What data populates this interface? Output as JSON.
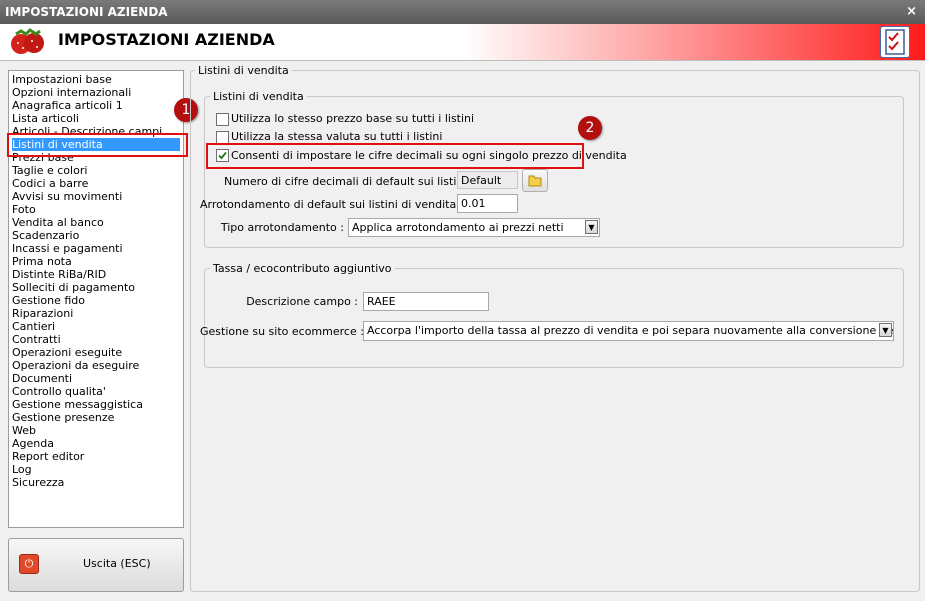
{
  "window": {
    "title": "IMPOSTAZIONI AZIENDA",
    "close_glyph": "×"
  },
  "header": {
    "title": "IMPOSTAZIONI AZIENDA",
    "logo_icon": "strawberry-icon",
    "checklist_icon": "checklist-icon"
  },
  "sidebar": {
    "items": [
      "Impostazioni base",
      "Opzioni internazionali",
      "Anagrafica articoli 1",
      "Lista articoli",
      "Articoli - Descrizione campi",
      "Listini di vendita",
      "Prezzi base",
      "Taglie e colori",
      "Codici a barre",
      "Avvisi su movimenti",
      "Foto",
      "Vendita al banco",
      "Scadenzario",
      "Incassi e pagamenti",
      "Prima nota",
      "Distinte RiBa/RID",
      "Solleciti di pagamento",
      "Gestione fido",
      "Riparazioni",
      "Cantieri",
      "Contratti",
      "Operazioni eseguite",
      "Operazioni da eseguire",
      "Documenti",
      "Controllo qualita'",
      "Gestione messaggistica",
      "Gestione presenze",
      "Web",
      "Agenda",
      "Report editor",
      "Log",
      "Sicurezza"
    ],
    "selected": "Listini di vendita"
  },
  "exit_button": {
    "label": "Uscita (ESC)",
    "icon": "power-icon"
  },
  "badges": {
    "one": "1",
    "two": "2"
  },
  "panel": {
    "title": "Listini di vendita",
    "group_listini": {
      "title": "Listini di vendita",
      "check_same_price": {
        "label": "Utilizza lo stesso prezzo base su tutti i listini",
        "checked": false
      },
      "check_same_currency": {
        "label": "Utilizza la stessa valuta su tutti i listini",
        "checked": false
      },
      "check_decimals": {
        "label": "Consenti di impostare le cifre decimali su ogni singolo prezzo di vendita",
        "checked": true
      },
      "decimals_label": "Numero di cifre decimali di default sui listini :",
      "decimals_value": "Default",
      "rounding_label": "Arrotondamento di default sui listini di vendita :",
      "rounding_value": "0.01",
      "rounding_type_label": "Tipo arrotondamento :",
      "rounding_type_value": "Applica arrotondamento ai prezzi netti"
    },
    "group_tax": {
      "title": "Tassa / ecocontributo aggiuntivo",
      "desc_label": "Descrizione campo :",
      "desc_value": "RAEE",
      "ecommerce_label": "Gestione su sito ecommerce :",
      "ecommerce_value": "Accorpa l'importo della tassa al prezzo di vendita e poi separa nuovamente alla conversione dell'ordine web"
    }
  }
}
